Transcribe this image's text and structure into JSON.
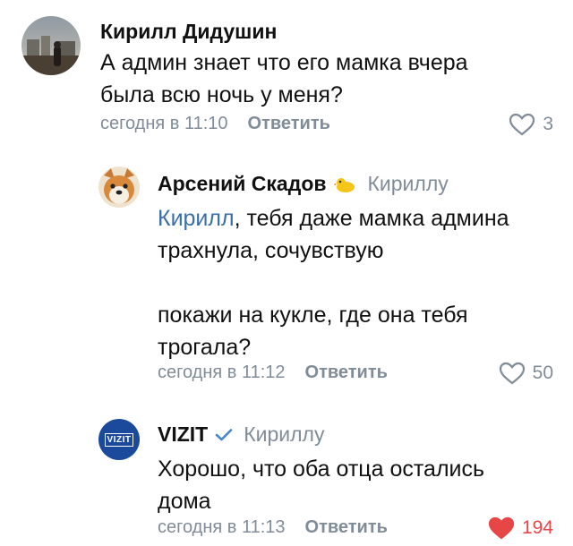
{
  "comments": [
    {
      "author": "Кирилл Дидушин",
      "text_lines": [
        "А админ знает что его мамка вчера",
        "была всю ночь у меня?"
      ],
      "time": "сегодня в 11:10",
      "reply_label": "Ответить",
      "likes": "3",
      "liked": false,
      "avatar_icon": "photo-avatar"
    },
    {
      "author": "Арсений Скадов",
      "reply_to": "Кириллу",
      "mention": "Кирилл",
      "text_line1_rest": ", тебя даже мамка админа",
      "text_line2": "трахнула, сочувствую",
      "text_line3": "покажи на кукле, где она тебя",
      "text_line4": "трогала?",
      "time": "сегодня в 11:12",
      "reply_label": "Ответить",
      "likes": "50",
      "liked": false,
      "avatar_icon": "dog-avatar",
      "badge_icon": "duck-emoji-icon"
    },
    {
      "author": "VIZIT",
      "reply_to": "Кириллу",
      "text_lines": [
        "Хорошо, что оба отца остались",
        "дома"
      ],
      "time": "сегодня в 11:13",
      "reply_label": "Ответить",
      "likes": "194",
      "liked": true,
      "avatar_text": "VIZIT",
      "avatar_color": "#1b4a9c",
      "verified_icon": "checkmark-icon"
    }
  ],
  "colors": {
    "muted": "#818c99",
    "like_active": "#e64646",
    "mention": "#3a6fa8",
    "verified": "#4a86cc"
  }
}
